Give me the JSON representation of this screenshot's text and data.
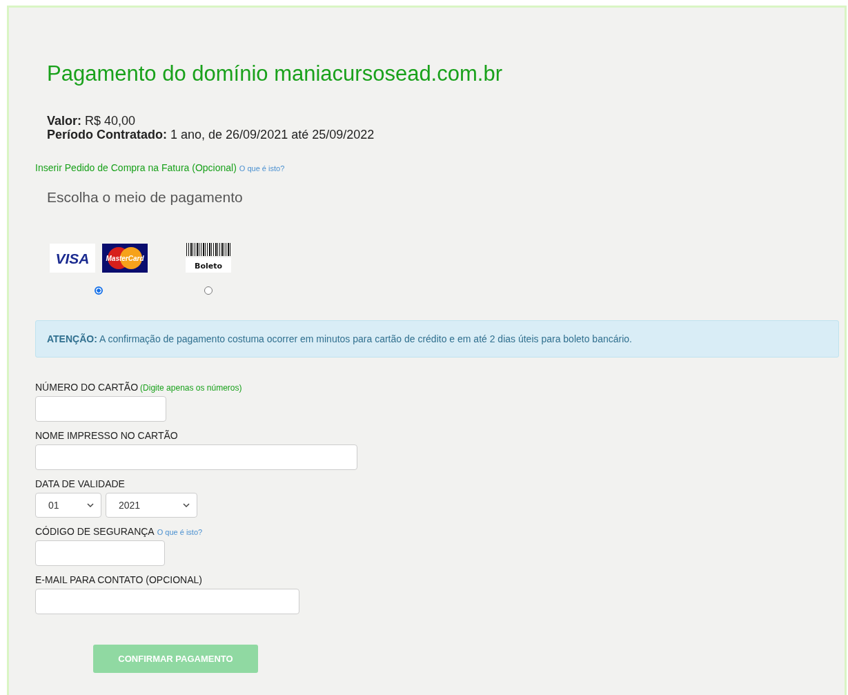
{
  "title": "Pagamento do domínio maniacursosead.com.br",
  "summary": [
    {
      "label": "Valor:",
      "value": "R$ 40,00"
    },
    {
      "label": "Período Contratado:",
      "value": "1 ano, de 26/09/2021 até 25/09/2022"
    }
  ],
  "purchase_order": {
    "text": "Inserir Pedido de Compra na Fatura (Opcional)",
    "help_link": "O que é isto?"
  },
  "payment_heading": "Escolha o meio de pagamento",
  "payment_methods": [
    {
      "kind": "cards",
      "logos": [
        "VISA",
        "MasterCard"
      ],
      "selected": true
    },
    {
      "kind": "boleto",
      "logos": [
        "Boleto"
      ],
      "selected": false
    }
  ],
  "alert": {
    "label": "ATENÇÃO:",
    "text": "A confirmação de pagamento costuma ocorrer em minutos para cartão de crédito e em até 2 dias úteis para boleto bancário."
  },
  "fields": [
    {
      "kind": "text",
      "label": "NÚMERO DO CARTÃO",
      "hint": "(Digite apenas os números)"
    },
    {
      "kind": "text",
      "label": "NOME IMPRESSO NO CARTÃO"
    },
    {
      "kind": "selects",
      "label": "DATA DE VALIDADE",
      "values": [
        "01",
        "2021"
      ]
    },
    {
      "kind": "text",
      "label": "CÓDIGO DE SEGURANÇA",
      "help_link": "O que é isto?"
    },
    {
      "kind": "text",
      "label": "E-MAIL PARA CONTATO (OPCIONAL)"
    }
  ],
  "submit": {
    "label": "CONFIRMAR PAGAMENTO",
    "disabled": true
  }
}
